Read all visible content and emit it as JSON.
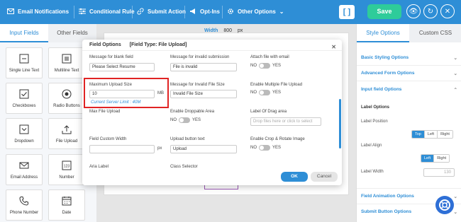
{
  "colors": {
    "primary": "#2e8ed6",
    "save": "#2ecc9a",
    "highlight": "#e02424"
  },
  "topbar": {
    "items": [
      {
        "label": "Email Notifications",
        "icon": "mail-icon"
      },
      {
        "label": "Conditional Rule",
        "icon": "sliders-icon"
      },
      {
        "label": "Submit Action",
        "icon": "link-icon"
      },
      {
        "label": "Opt-Ins",
        "icon": "megaphone-icon"
      },
      {
        "label": "Other Options",
        "icon": "gear-icon"
      }
    ],
    "bracket_label": "[ ]",
    "save_label": "Save"
  },
  "left_panel": {
    "tabs": [
      "Input Fields",
      "Other Fields"
    ],
    "fields": [
      {
        "label": "Single Line Text",
        "icon": "single-line-text-icon"
      },
      {
        "label": "Multiline Text",
        "icon": "multiline-text-icon"
      },
      {
        "label": "Checkboxes",
        "icon": "checkbox-icon"
      },
      {
        "label": "Radio Buttons",
        "icon": "radio-icon"
      },
      {
        "label": "Dropdown",
        "icon": "dropdown-icon"
      },
      {
        "label": "File Upload",
        "icon": "upload-icon"
      },
      {
        "label": "Email Address",
        "icon": "email-icon"
      },
      {
        "label": "Number",
        "icon": "number-icon"
      },
      {
        "label": "Phone Number",
        "icon": "phone-icon"
      },
      {
        "label": "Date",
        "icon": "calendar-icon"
      }
    ]
  },
  "canvas": {
    "width_label": "Width",
    "width_value": "800",
    "width_unit": "px"
  },
  "right_panel": {
    "tabs": [
      "Style Options",
      "Custom CSS"
    ],
    "sections": {
      "basic": "Basic Styling Options",
      "advanced": "Advanced Form Options",
      "input": "Input field Options",
      "label_options": "Label Options",
      "label_position": "Label Position",
      "label_align": "Label Align",
      "label_width": "Label Width",
      "label_width_value": "130",
      "animation": "Field Animation Options",
      "submit": "Submit Button Options"
    },
    "position_options": [
      "Top",
      "Left",
      "Right"
    ],
    "align_options": [
      "Left",
      "Right"
    ]
  },
  "modal": {
    "title": "Field Options",
    "type": "[Field Type: File Upload]",
    "fields": {
      "blank_label": "Message for blank field",
      "blank_value": "Please Select Resume",
      "invalid_label": "Message for invalid submission",
      "invalid_value": "File is invalid",
      "attach_label": "Attach file with email",
      "max_size_label": "Maximum Upload Size",
      "max_size_value": "10",
      "max_size_unit": "MB",
      "server_limit": "Current Server Limit : 40M",
      "invalid_size_label": "Message for Invalid File Size",
      "invalid_size_value": "Invalid File Size",
      "multi_label": "Enable Multiple File Upload",
      "max_file_label": "Max File Upload",
      "droppable_label": "Enable Droppable Area",
      "drag_label": "Label Of Drag area",
      "drag_placeholder": "Drop files here or click to select",
      "custom_width_label": "Field Custom Width",
      "custom_width_unit": "px",
      "upload_btn_label": "Upload button text",
      "upload_btn_value": "Upload",
      "crop_label": "Enable Crop & Rotate Image",
      "aria_label": "Aria Label",
      "class_label": "Class Selector",
      "no": "NO",
      "yes": "YES"
    },
    "ok_label": "OK",
    "cancel_label": "Cancel"
  }
}
